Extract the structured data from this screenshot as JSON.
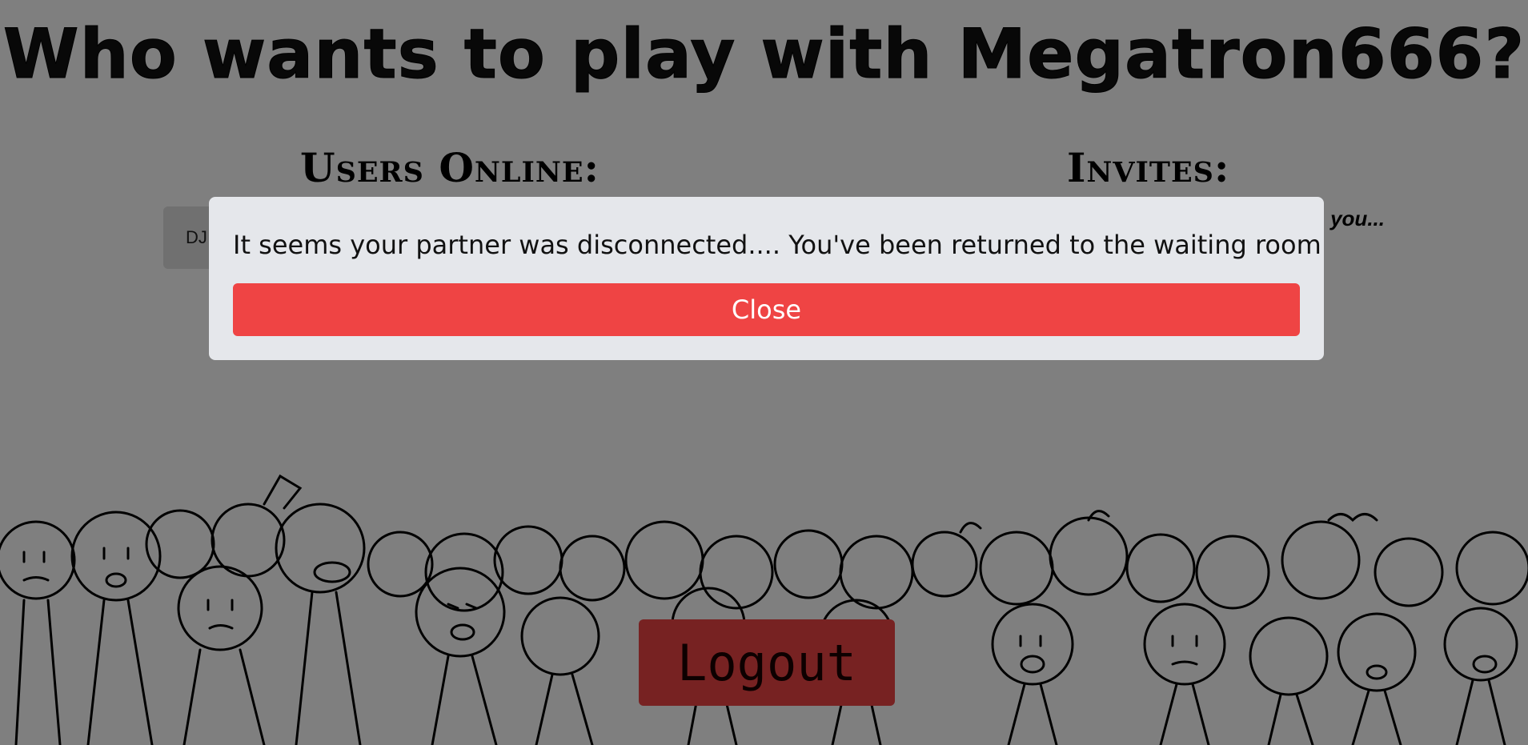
{
  "header": {
    "title": "Who wants to play with Megatron666?"
  },
  "users_online": {
    "heading": "Users Online:",
    "users": [
      "DJ"
    ]
  },
  "invites": {
    "heading": "Invites:",
    "empty_text": "you..."
  },
  "footer": {
    "logout_label": "Logout"
  },
  "modal": {
    "message": "It seems your partner was disconnected.... You've been returned to the waiting room",
    "close_label": "Close"
  },
  "colors": {
    "accent_red": "#ef4444",
    "modal_bg": "#e5e7eb",
    "overlay": "rgba(0,0,0,0.5)"
  },
  "icons": {
    "background_art": "crowd-of-stick-figures-illustration"
  }
}
